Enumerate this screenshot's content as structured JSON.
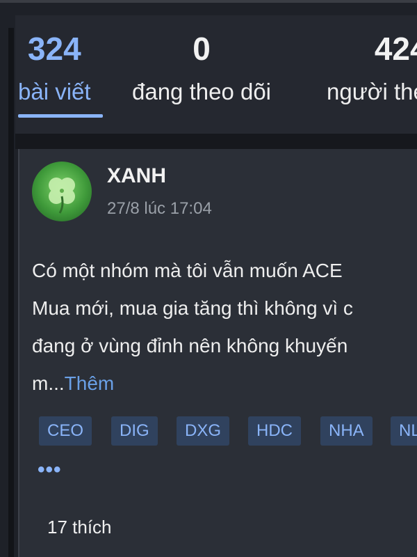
{
  "profile_stats": {
    "posts": {
      "count": "324",
      "label": "bài viết"
    },
    "following": {
      "count": "0",
      "label": "đang theo dõi"
    },
    "followers": {
      "count": "424",
      "label": "người theo dõi"
    }
  },
  "post": {
    "author": "XANH",
    "timestamp": "27/8 lúc 17:04",
    "avatar_icon": "clover-icon",
    "content_lines": [
      "Có một nhóm mà tôi vẫn muốn ACE",
      "Mua mới, mua gia tăng thì không vì c",
      "đang ở vùng đỉnh nên không khuyến",
      "m..."
    ],
    "more_label": "Thêm",
    "tags": [
      "CEO",
      "DIG",
      "DXG",
      "HDC",
      "NHA",
      "NLG"
    ],
    "more_tags": "•••",
    "likes": "17 thích"
  },
  "colors": {
    "accent": "#8ab4f8",
    "background": "#1e2128",
    "card": "#2b2f37",
    "tag_bg": "#30425e"
  }
}
